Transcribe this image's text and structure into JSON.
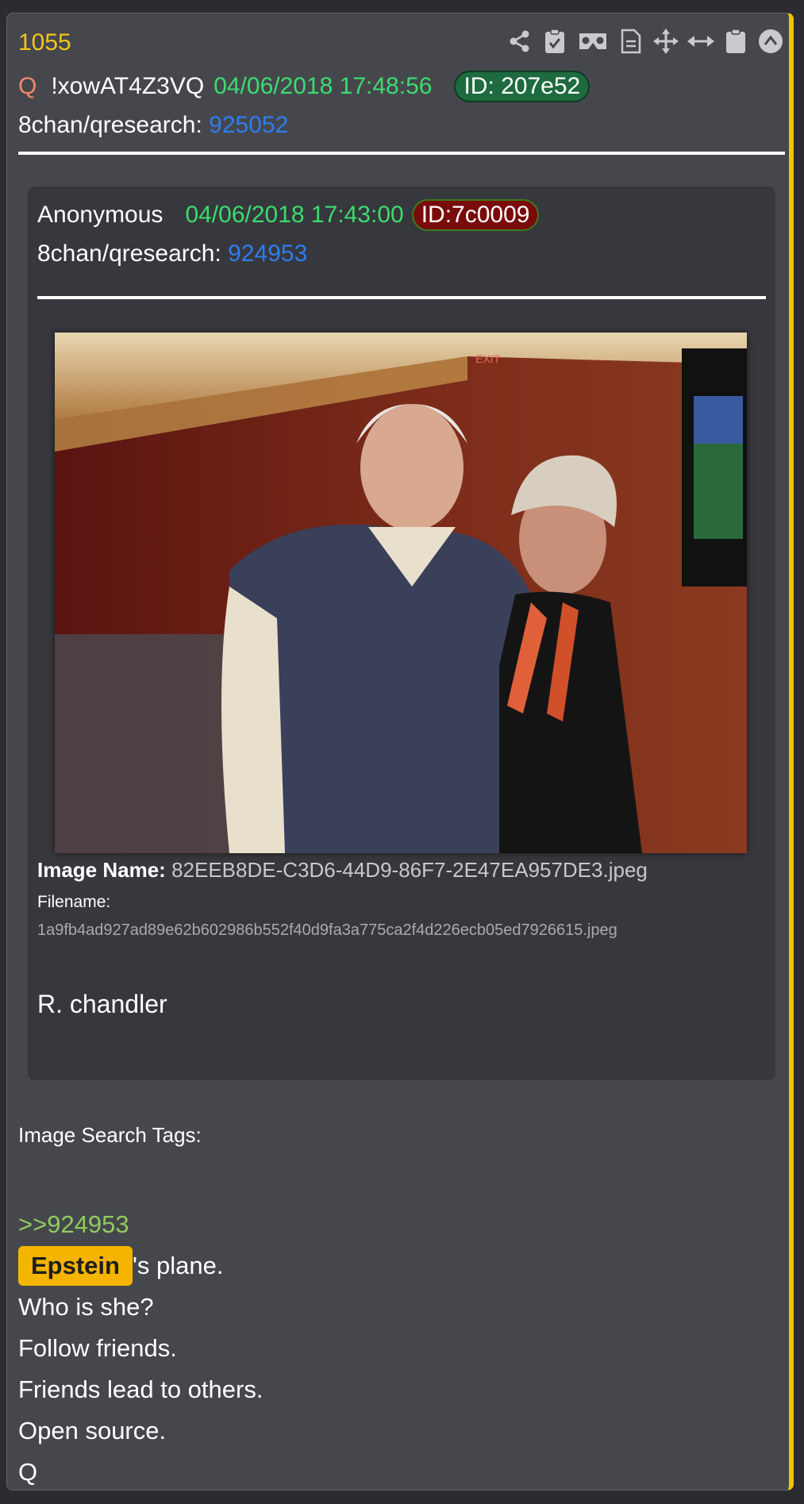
{
  "post": {
    "number": "1055",
    "q_letter": "Q",
    "tripcode": "!xowAT4Z3VQ",
    "datetime": "04/06/2018 17:48:56",
    "id_label": "ID: 207e52",
    "board_label": "8chan/qresearch:",
    "board_post": "925052"
  },
  "toolbar": {
    "icons": [
      "share-icon",
      "clipboard-check-icon",
      "vr-headset-icon",
      "document-icon",
      "move-arrows-icon",
      "horizontal-arrows-icon",
      "clipboard-icon",
      "scroll-up-icon"
    ]
  },
  "quoted": {
    "author": "Anonymous",
    "datetime": "04/06/2018 17:43:00",
    "id_label": "ID:7c0009",
    "board_label": "8chan/qresearch:",
    "board_post": "924953",
    "image_name_label": "Image Name:",
    "image_name": "82EEB8DE-C3D6-44D9-86F7-2E47EA957DE3.jpeg",
    "filename_label": "Filename:",
    "filename": "1a9fb4ad927ad89e62b602986b552f40d9fa3a775ca2f4d226ecb05ed7926615.jpeg",
    "body": "R. chandler"
  },
  "tags": {
    "label": "Image Search Tags:"
  },
  "body": {
    "reply_link": ">>924953",
    "highlight": "Epstein",
    "line1_rest": "'s plane.",
    "line2": "Who is she?",
    "line3": "Follow friends.",
    "line4": "Friends lead to others.",
    "line5": "Open source.",
    "line6": "Q"
  },
  "colors": {
    "accent_yellow": "#f5c518",
    "date_green": "#3bdc6e",
    "link_blue": "#2f7cf0",
    "reply_green": "#8fcc5f",
    "highlight": "#f5b400",
    "id_green": "#1e6b3f",
    "id_red": "#7a0b0b"
  }
}
